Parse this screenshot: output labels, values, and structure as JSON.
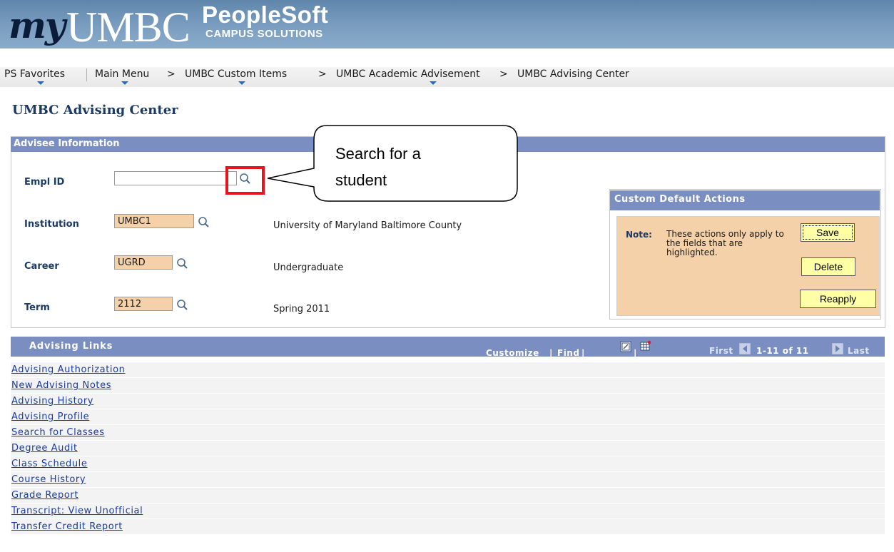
{
  "header": {
    "logo_my": "my",
    "logo_umbc": "UMBC",
    "logo_peoplesoft": "PeopleSoft",
    "logo_campus": "CAMPUS SOLUTIONS"
  },
  "breadcrumb": {
    "favorites": "PS Favorites",
    "main_menu": "Main Menu",
    "sep1": ">",
    "custom_items": "UMBC Custom Items",
    "sep2": ">",
    "academic_advisement": "UMBC Academic Advisement",
    "sep3": ">",
    "advising_center": "UMBC Advising Center"
  },
  "page_title": "UMBC Advising Center",
  "advisee": {
    "section_title": "Advisee Information",
    "empl_id_label": "Empl ID",
    "empl_id_value": "",
    "institution_label": "Institution",
    "institution_value": "UMBC1",
    "institution_desc": "University of Maryland Baltimore County",
    "career_label": "Career",
    "career_value": "UGRD",
    "career_desc": "Undergraduate",
    "term_label": "Term",
    "term_value": "2112",
    "term_desc": "Spring 2011"
  },
  "callout": {
    "line1": "Search for a",
    "line2": "student"
  },
  "custom_defaults": {
    "title": "Custom Default Actions",
    "note_label": "Note:",
    "note_text": "These actions only apply to the fields that are highlighted.",
    "save": "Save",
    "delete": "Delete",
    "reapply": "Reapply"
  },
  "advising_links": {
    "title": "Advising Links",
    "customize": "Customize",
    "find": "Find",
    "first": "First",
    "range": "1-11 of 11",
    "last": "Last",
    "links": [
      "Advising Authorization",
      "New Advising Notes",
      "Advising History",
      "Advising Profile",
      "Search for Classes",
      "Degree Audit",
      "Class Schedule",
      "Course History",
      "Grade Report",
      "Transcript: View Unofficial",
      "Transfer Credit Report"
    ]
  },
  "colors": {
    "header_blue": "#7a8ec2",
    "highlight_field": "#f4d1a8",
    "button_yellow": "#ffffa6",
    "callout_red": "#e8141c"
  }
}
